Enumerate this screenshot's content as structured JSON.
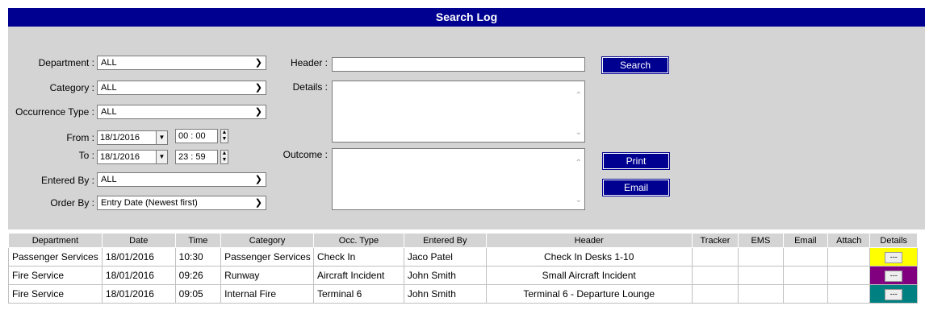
{
  "title": "Search Log",
  "form": {
    "department": {
      "label": "Department :",
      "value": "ALL"
    },
    "category": {
      "label": "Category :",
      "value": "ALL"
    },
    "occurrence_type": {
      "label": "Occurrence Type :",
      "value": "ALL"
    },
    "from": {
      "label": "From :",
      "date": "18/1/2016",
      "hour": "00",
      "minute": "00"
    },
    "to": {
      "label": "To :",
      "date": "18/1/2016",
      "hour": "23",
      "minute": "59"
    },
    "entered_by": {
      "label": "Entered By :",
      "value": "ALL"
    },
    "order_by": {
      "label": "Order By :",
      "value": "Entry Date (Newest first)"
    },
    "header": {
      "label": "Header :",
      "value": ""
    },
    "details": {
      "label": "Details :",
      "value": ""
    },
    "outcome": {
      "label": "Outcome :",
      "value": ""
    }
  },
  "buttons": {
    "search": "Search",
    "print": "Print",
    "email": "Email"
  },
  "table": {
    "columns": [
      "Department",
      "Date",
      "Time",
      "Category",
      "Occ. Type",
      "Entered By",
      "Header",
      "Tracker",
      "EMS",
      "Email",
      "Attach",
      "Details"
    ],
    "rows": [
      {
        "department": "Passenger Services",
        "date": "18/01/2016",
        "time": "10:30",
        "category": "Passenger Services",
        "occ_type": "Check In",
        "entered_by": "Jaco Patel",
        "header": "Check In Desks 1-10",
        "details_color": "#ffff00",
        "details_label": "---"
      },
      {
        "department": "Fire Service",
        "date": "18/01/2016",
        "time": "09:26",
        "category": "Runway",
        "occ_type": "Aircraft Incident",
        "entered_by": "John Smith",
        "header": "Small Aircraft Incident",
        "details_color": "#800080",
        "details_label": "---"
      },
      {
        "department": "Fire Service",
        "date": "18/01/2016",
        "time": "09:05",
        "category": "Internal Fire",
        "occ_type": "Terminal 6",
        "entered_by": "John Smith",
        "header": "Terminal 6 - Departure Lounge",
        "details_color": "#008080",
        "details_label": "---"
      }
    ]
  },
  "colors": {
    "accent": "#000090",
    "panel": "#d4d4d4"
  }
}
